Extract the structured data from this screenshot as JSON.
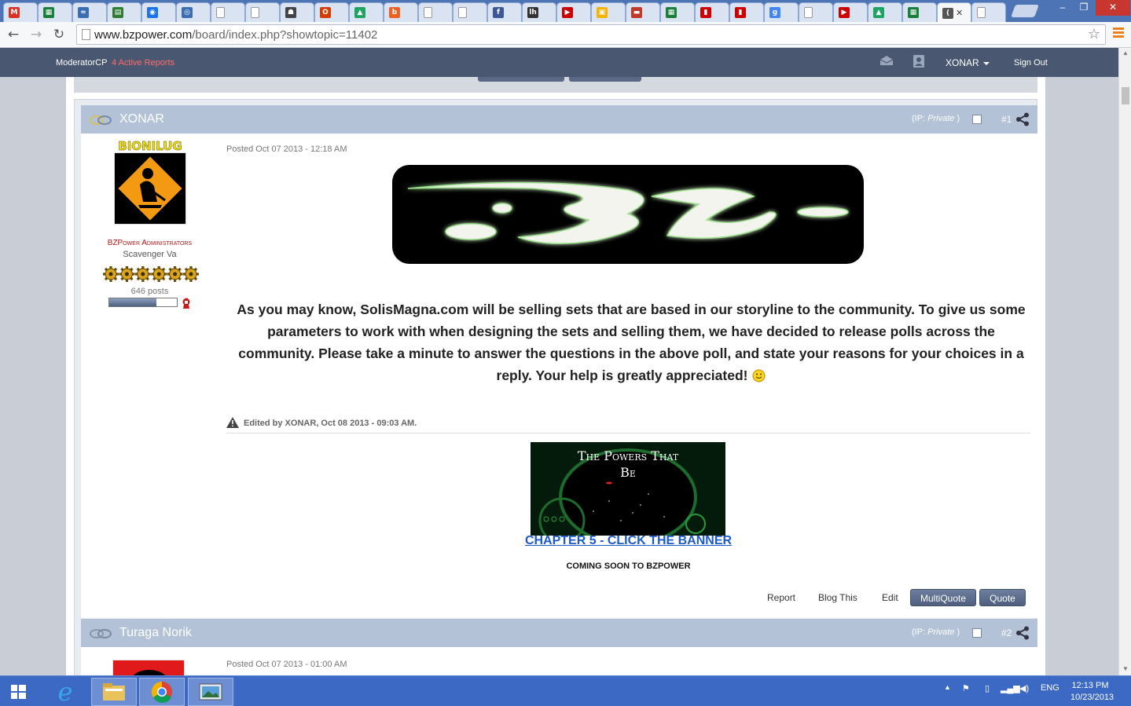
{
  "browser": {
    "tabs": [
      {
        "icon": "gmail-icon",
        "glyph": "M",
        "color": "#d93025"
      },
      {
        "icon": "sheets-icon",
        "glyph": "▦",
        "color": "#188038"
      },
      {
        "icon": "wave-icon",
        "glyph": "≈",
        "color": "#3b6db3"
      },
      {
        "icon": "slides-icon",
        "glyph": "▤",
        "color": "#2e7d32"
      },
      {
        "icon": "chrome-circle-icon",
        "glyph": "◉",
        "color": "#1a73e8"
      },
      {
        "icon": "target-icon",
        "glyph": "◎",
        "color": "#3b6db3"
      },
      {
        "icon": "blank-page-icon",
        "glyph": "",
        "color": "#ffffff"
      },
      {
        "icon": "blank-page-icon",
        "glyph": "",
        "color": "#ffffff"
      },
      {
        "icon": "robot-icon",
        "glyph": "☗",
        "color": "#444444"
      },
      {
        "icon": "office-icon",
        "glyph": "O",
        "color": "#d83b01"
      },
      {
        "icon": "drive-icon",
        "glyph": "▲",
        "color": "#1da462"
      },
      {
        "icon": "bitly-icon",
        "glyph": "b",
        "color": "#ee6123",
        "text": "bitly"
      },
      {
        "icon": "blank-page-icon",
        "glyph": "",
        "color": "#ffffff"
      },
      {
        "icon": "blank-page-icon",
        "glyph": "",
        "color": "#ffffff"
      },
      {
        "icon": "facebook-icon",
        "glyph": "f",
        "color": "#3b5998"
      },
      {
        "icon": "lh-icon",
        "glyph": "lh",
        "color": "#333333"
      },
      {
        "icon": "youtube-icon",
        "glyph": "▶",
        "color": "#cc0000"
      },
      {
        "icon": "chat-icon",
        "glyph": "▣",
        "color": "#f4b400"
      },
      {
        "icon": "flag-icon",
        "glyph": "▬",
        "color": "#c0392b"
      },
      {
        "icon": "sheets-icon",
        "glyph": "▦",
        "color": "#188038"
      },
      {
        "icon": "battery-icon",
        "glyph": "▮",
        "color": "#cc0000"
      },
      {
        "icon": "battery-icon",
        "glyph": "▮",
        "color": "#cc0000"
      },
      {
        "icon": "google-icon",
        "glyph": "g",
        "color": "#4285f4"
      },
      {
        "icon": "blank-page-icon",
        "glyph": "",
        "color": "#ffffff"
      },
      {
        "icon": "youtube-icon",
        "glyph": "▶",
        "color": "#cc0000"
      },
      {
        "icon": "drive-icon",
        "glyph": "▲",
        "color": "#1da462"
      },
      {
        "icon": "sheets-icon",
        "glyph": "▦",
        "color": "#188038"
      },
      {
        "icon": "loading-icon",
        "glyph": "(",
        "color": "#555555",
        "active": true
      },
      {
        "icon": "blank-page-icon",
        "glyph": "",
        "color": "#ffffff"
      }
    ],
    "url_host": "www.bzpower.com",
    "url_path": "/board/index.php?showtopic=11402",
    "window_controls": {
      "minimize": "–",
      "restore": "❐",
      "close": "✕"
    }
  },
  "modbar": {
    "moderator_label": "ModeratorCP",
    "active_reports": "4 Active Reports",
    "username": "XONAR",
    "sign_out": "Sign Out"
  },
  "post1": {
    "author": "XONAR",
    "ip_prefix": "(IP: ",
    "ip_value": "Private",
    "ip_suffix": " )",
    "number": "#1",
    "user_title_image_text": "BIONILUG",
    "group": "BZPower Administrators",
    "rank": "Scavenger Va",
    "post_count": "646 posts",
    "reputation_fraction": 0.7,
    "gear_count": 6,
    "posted": "Posted Oct 07 2013 - 12:18 AM",
    "text": "As you may know, SolisMagna.com will be selling sets that are based in our storyline to the community. To give us some parameters to work with when designing the sets and selling them, we have decided to release polls across the community. Please take a minute to answer the questions in the above poll, and state your reasons for your choices in a reply. Your help is greatly appreciated!",
    "edited": "Edited by XONAR, Oct 08 2013 - 09:03 AM.",
    "signature_banner_title": "The Powers That Be",
    "signature_link": "CHAPTER 5 - CLICK THE BANNER",
    "signature_note": "COMING SOON TO BZPOWER",
    "actions": {
      "report": "Report",
      "blog": "Blog This",
      "edit": "Edit",
      "multiquote": "MultiQuote",
      "quote": "Quote"
    }
  },
  "post2": {
    "author": "Turaga Norik",
    "ip_prefix": "(IP: ",
    "ip_value": "Private",
    "ip_suffix": " )",
    "number": "#2",
    "posted": "Posted Oct 07 2013 - 01:00 AM"
  },
  "taskbar": {
    "apps": [
      "start-icon",
      "internet-explorer-icon",
      "file-explorer-icon",
      "chrome-icon",
      "photo-viewer-icon"
    ],
    "language": "ENG",
    "time": "12:13 PM",
    "date": "10/23/2013"
  },
  "colors": {
    "header_bar": "#4a5770",
    "post_header": "#b3c2d6",
    "link_blue": "#1c5bc7",
    "reports_red": "#ff6b6b",
    "taskbar": "#3c69c4"
  }
}
